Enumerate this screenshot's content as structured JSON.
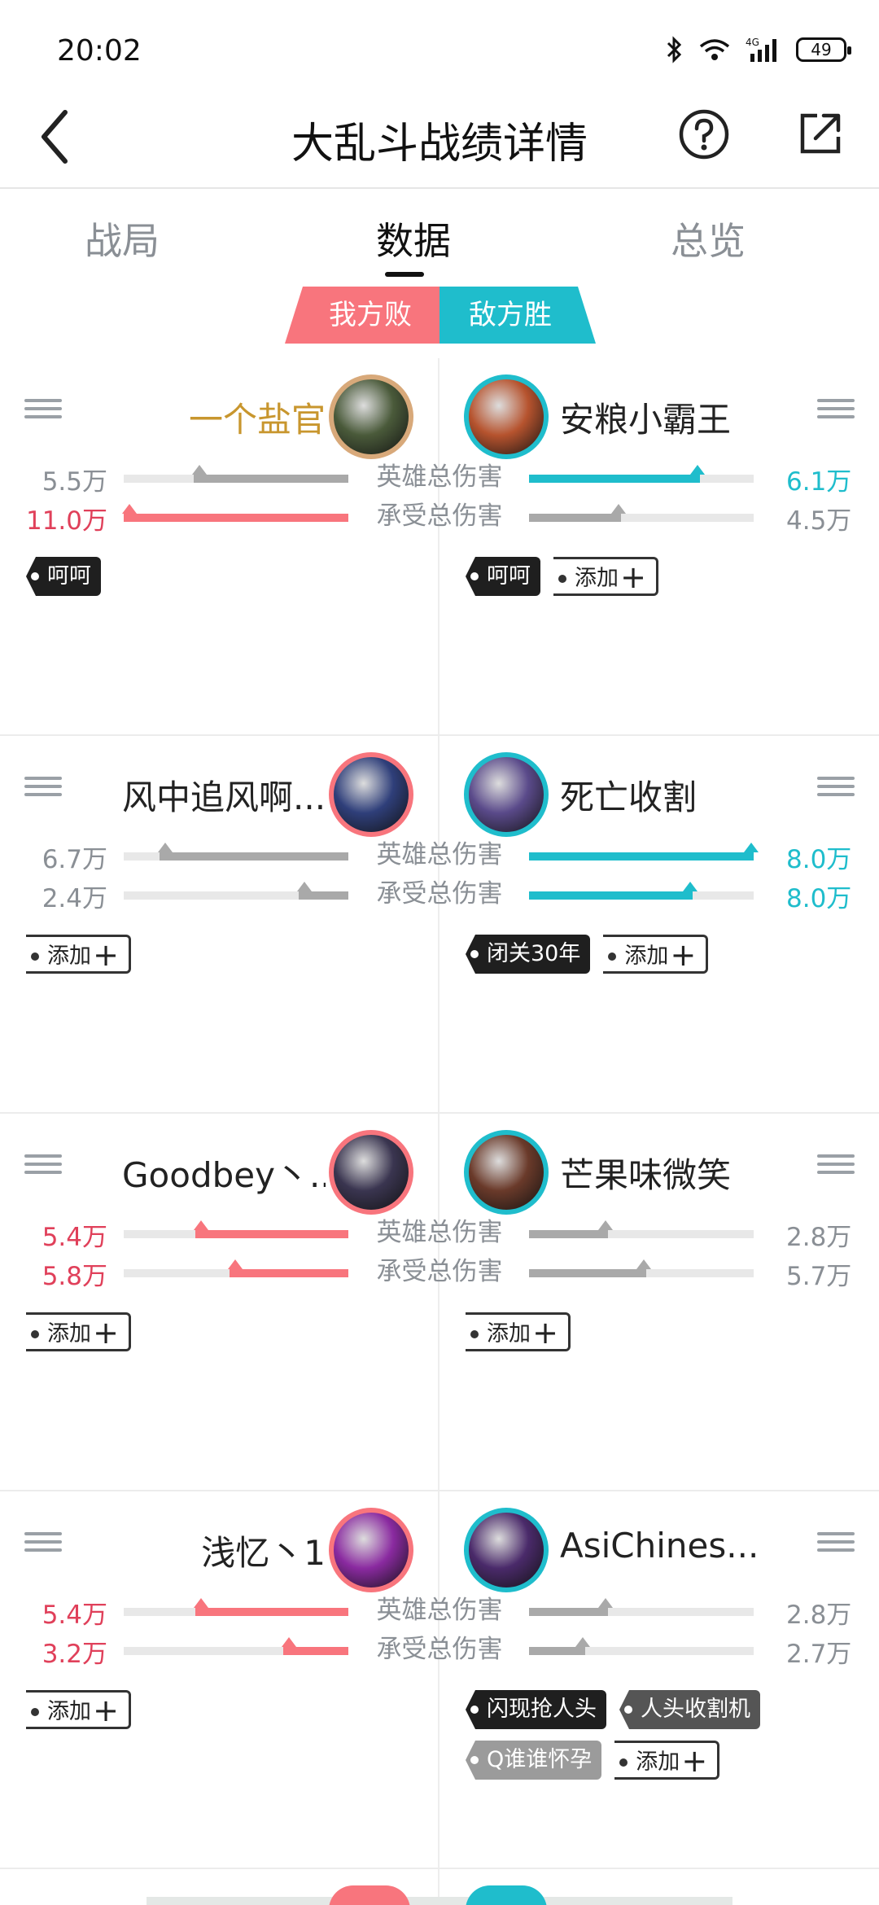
{
  "status": {
    "time": "20:02",
    "battery": "49",
    "network": "4G"
  },
  "header": {
    "title": "大乱斗战绩详情"
  },
  "tabs": [
    {
      "label": "战局",
      "active": false
    },
    {
      "label": "数据",
      "active": true
    },
    {
      "label": "总览",
      "active": false
    }
  ],
  "result": {
    "ours": "我方败",
    "theirs": "敌方胜"
  },
  "metrics": {
    "damage": "英雄总伤害",
    "taken": "承受总伤害"
  },
  "colors": {
    "red": "#f8757d",
    "cyan": "#1fbdcc",
    "gray": "#a9a9a9",
    "gold": "#c8962e"
  },
  "rows": [
    {
      "left": {
        "name": "一个盐官",
        "name_color": "#c8962e",
        "damage": "5.5万",
        "damage_color": "#8a8f95",
        "damage_ratio": 0.69,
        "damage_fill": "gray",
        "taken": "11.0万",
        "taken_color": "#e0405a",
        "taken_ratio": 1.0,
        "taken_fill": "red",
        "tags": [
          {
            "text": "呵呵",
            "style": "dark"
          }
        ],
        "ring": "#d8a97a",
        "avatar": "#4a5a3a"
      },
      "right": {
        "name": "安粮小霸王",
        "name_color": "#222222",
        "damage": "6.1万",
        "damage_color": "#1fbdcc",
        "damage_ratio": 0.76,
        "damage_fill": "cyan",
        "taken": "4.5万",
        "taken_color": "#8a8f95",
        "taken_ratio": 0.41,
        "taken_fill": "gray",
        "tags": [
          {
            "text": "呵呵",
            "style": "dark"
          },
          {
            "text": "添加",
            "style": "add"
          }
        ],
        "ring": "#1fbdcc",
        "avatar": "#b6532e"
      }
    },
    {
      "left": {
        "name": "风中追风啊...",
        "name_color": "#222222",
        "damage": "6.7万",
        "damage_color": "#8a8f95",
        "damage_ratio": 0.84,
        "damage_fill": "gray",
        "taken": "2.4万",
        "taken_color": "#8a8f95",
        "taken_ratio": 0.22,
        "taken_fill": "gray",
        "tags": [
          {
            "text": "添加",
            "style": "add"
          }
        ],
        "ring": "#f8757d",
        "avatar": "#2f3f7a"
      },
      "right": {
        "name": "死亡收割",
        "name_color": "#222222",
        "damage": "8.0万",
        "damage_color": "#1fbdcc",
        "damage_ratio": 1.0,
        "damage_fill": "cyan",
        "taken": "8.0万",
        "taken_color": "#1fbdcc",
        "taken_ratio": 0.73,
        "taken_fill": "cyan",
        "tags": [
          {
            "text": "闭关30年",
            "style": "dark"
          },
          {
            "text": "添加",
            "style": "add"
          }
        ],
        "ring": "#1fbdcc",
        "avatar": "#5a4a8a"
      }
    },
    {
      "left": {
        "name": "Goodbey丶...",
        "name_color": "#222222",
        "damage": "5.4万",
        "damage_color": "#e0405a",
        "damage_ratio": 0.68,
        "damage_fill": "red",
        "taken": "5.8万",
        "taken_color": "#e0405a",
        "taken_ratio": 0.53,
        "taken_fill": "red",
        "tags": [
          {
            "text": "添加",
            "style": "add"
          }
        ],
        "ring": "#f8757d",
        "avatar": "#3a3550"
      },
      "right": {
        "name": "芒果味微笑",
        "name_color": "#222222",
        "damage": "2.8万",
        "damage_color": "#8a8f95",
        "damage_ratio": 0.35,
        "damage_fill": "gray",
        "taken": "5.7万",
        "taken_color": "#8a8f95",
        "taken_ratio": 0.52,
        "taken_fill": "gray",
        "tags": [
          {
            "text": "添加",
            "style": "add"
          }
        ],
        "ring": "#1fbdcc",
        "avatar": "#6a3a2a"
      }
    },
    {
      "left": {
        "name": "浅忆丶1",
        "name_color": "#222222",
        "damage": "5.4万",
        "damage_color": "#e0405a",
        "damage_ratio": 0.68,
        "damage_fill": "red",
        "taken": "3.2万",
        "taken_color": "#e0405a",
        "taken_ratio": 0.29,
        "taken_fill": "red",
        "tags": [
          {
            "text": "添加",
            "style": "add"
          }
        ],
        "ring": "#f8757d",
        "avatar": "#8a2aa0"
      },
      "right": {
        "name": "AsiChines...",
        "name_color": "#222222",
        "damage": "2.8万",
        "damage_color": "#8a8f95",
        "damage_ratio": 0.35,
        "damage_fill": "gray",
        "taken": "2.7万",
        "taken_color": "#8a8f95",
        "taken_ratio": 0.25,
        "taken_fill": "gray",
        "tags": [
          {
            "text": "闪现抢人头",
            "style": "dark"
          },
          {
            "text": "人头收割机",
            "style": "mid"
          },
          {
            "text": "Q谁谁怀孕",
            "style": "light"
          },
          {
            "text": "添加",
            "style": "add"
          }
        ],
        "ring": "#1fbdcc",
        "avatar": "#4a2a6a"
      }
    }
  ]
}
